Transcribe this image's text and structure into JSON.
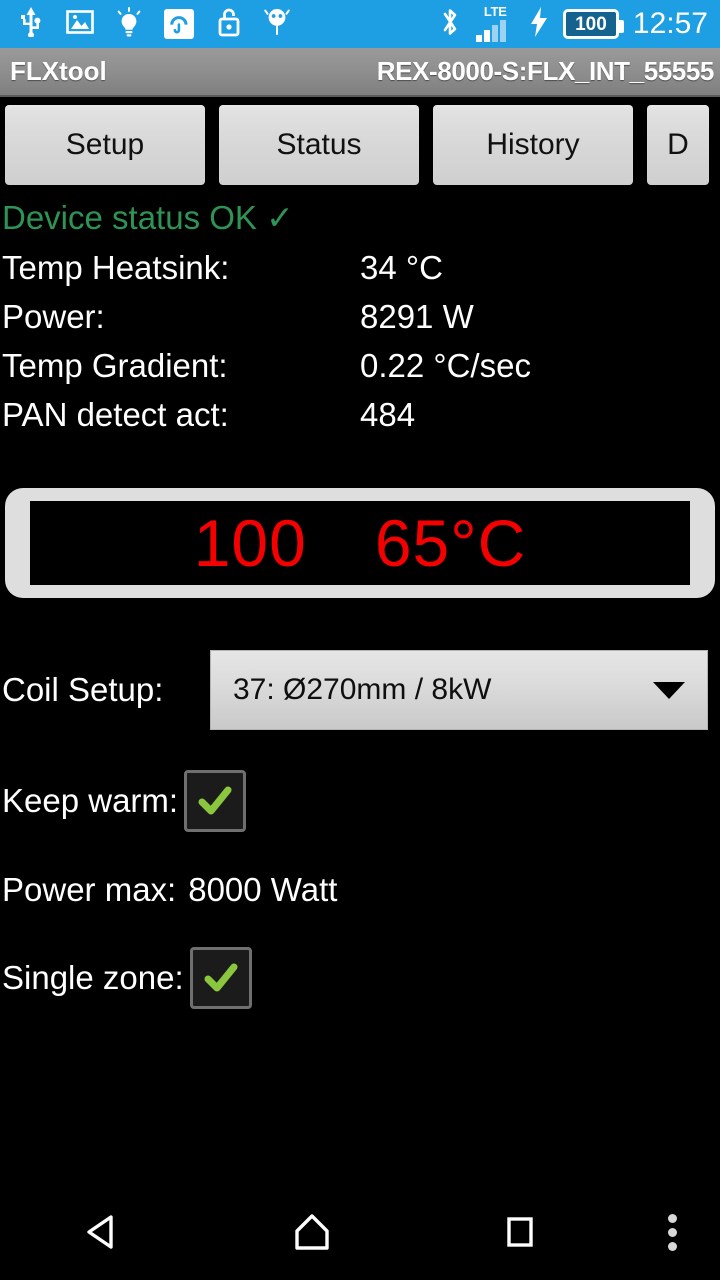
{
  "statusbar": {
    "icons": [
      "usb-icon",
      "image-icon",
      "lightbulb-icon",
      "avira-icon",
      "unlocked-padlock-icon",
      "android-debug-icon"
    ],
    "bluetooth_icon": "bluetooth-icon",
    "network_label": "LTE",
    "charging_icon": "charging-bolt-icon",
    "battery_level": "100",
    "time": "12:57"
  },
  "titlebar": {
    "app_title": "FLXtool",
    "device_id": "REX-8000-S:FLX_INT_55555"
  },
  "tabs": [
    {
      "label": "Setup"
    },
    {
      "label": "Status"
    },
    {
      "label": "History"
    },
    {
      "label": "D"
    }
  ],
  "status": {
    "device_status": "Device status OK ✓",
    "device_status_color": "#2e9455",
    "rows": [
      {
        "label": "Temp Heatsink:",
        "value": "34 °C"
      },
      {
        "label": "Power:",
        "value": "8291 W"
      },
      {
        "label": "Temp Gradient:",
        "value": "0.22 °C/sec"
      },
      {
        "label": "PAN detect act:",
        "value": "484"
      }
    ]
  },
  "led_display": {
    "value_left": "100",
    "value_right": "65°C",
    "text_color": "#f50000",
    "background_color": "#000000",
    "frame_color": "#dedede"
  },
  "settings": {
    "coil_setup_label": "Coil Setup:",
    "coil_setup_value": "37: Ø270mm / 8kW",
    "coil_setup_caret": "chevron-down-icon",
    "keep_warm_label": "Keep warm:",
    "keep_warm_checked": "✔",
    "power_max_label": "Power max:",
    "power_max_value": "8000 Watt",
    "single_zone_label": "Single zone:",
    "single_zone_checked": "✔",
    "check_color": "#8bc63f"
  },
  "navbar": {
    "back": "back-icon",
    "home": "home-icon",
    "recents": "recents-icon",
    "overflow": "overflow-menu-icon"
  }
}
